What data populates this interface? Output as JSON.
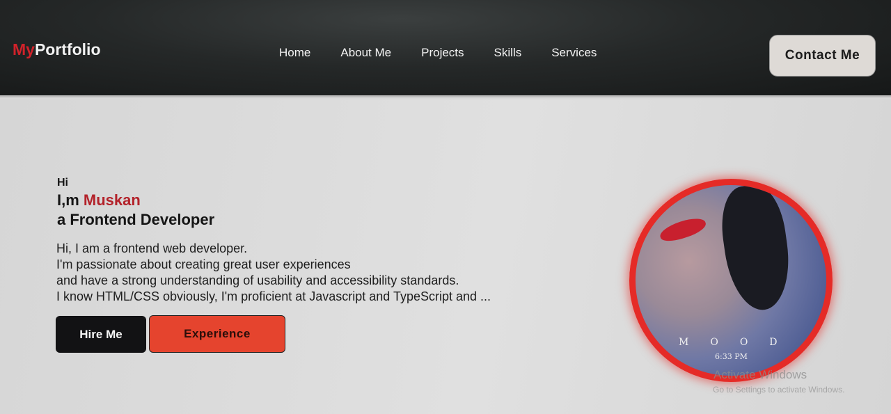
{
  "navbar": {
    "logo_accent": "My",
    "logo_rest": "Portfolio",
    "links": [
      "Home",
      "About Me",
      "Projects",
      "Skills",
      "Services"
    ],
    "contact_label": "Contact Me"
  },
  "hero": {
    "greeting": "Hi",
    "intro_prefix": "I,m ",
    "name": "Muskan",
    "role": "a Frontend Developer",
    "description": [
      "Hi, I am a frontend web developer.",
      "I'm passionate about creating great user experiences",
      "and have a strong understanding of usability and accessibility standards.",
      "I know HTML/CSS obviously, I'm proficient at Javascript and TypeScript and ..."
    ],
    "hire_label": "Hire Me",
    "experience_label": "Experience",
    "photo_overlay_text": "MOOD",
    "photo_overlay_time": "6:33 PM"
  },
  "watermark": {
    "title": "Activate Windows",
    "subtitle": "Go to Settings to activate Windows."
  },
  "colors": {
    "accent_red": "#d0222a",
    "experience_button": "#e5442e",
    "hire_button": "#121214",
    "avatar_ring": "#e52b27"
  },
  "icons": []
}
